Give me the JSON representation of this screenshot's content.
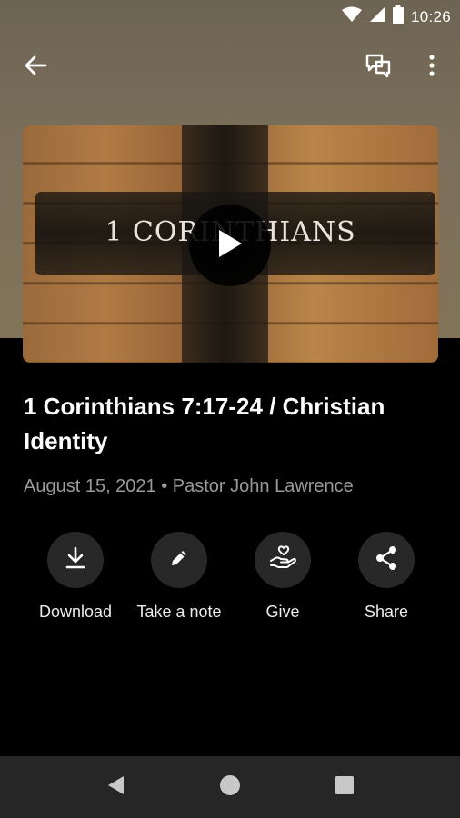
{
  "status_bar": {
    "time": "10:26"
  },
  "app_bar": {
    "back_icon": "arrow-left-icon",
    "chat_icon": "chat-icon",
    "more_icon": "more-vert-icon"
  },
  "video": {
    "thumbnail_text": "1 CORINTHIANS",
    "play_icon": "play-icon"
  },
  "sermon": {
    "title": "1 Corinthians 7:17-24 / Christian Identity",
    "meta": "August 15, 2021 • Pastor John Lawrence"
  },
  "actions": [
    {
      "label": "Download",
      "icon": "download-icon"
    },
    {
      "label": "Take a note",
      "icon": "pencil-icon"
    },
    {
      "label": "Give",
      "icon": "give-heart-hand-icon"
    },
    {
      "label": "Share",
      "icon": "share-icon"
    }
  ],
  "colors": {
    "header_background": "#7b6f5b",
    "page_background": "#000000",
    "action_circle": "#282828",
    "meta_text": "#9a9a9a",
    "nav_bar": "#262626"
  }
}
